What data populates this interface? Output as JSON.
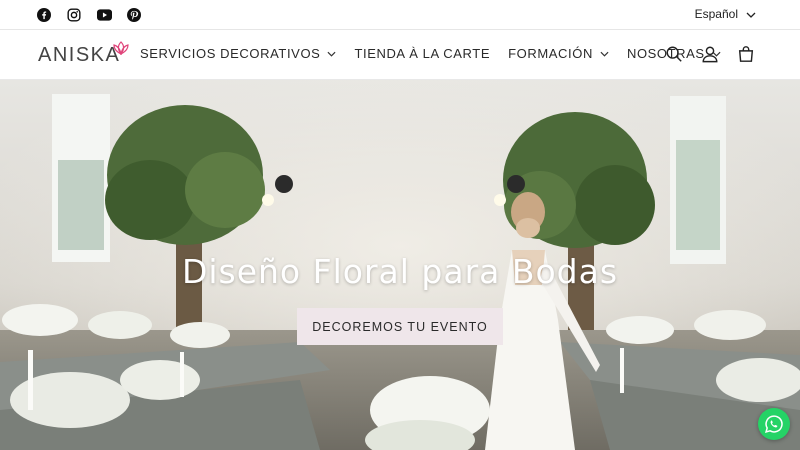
{
  "topbar": {
    "social": [
      "facebook-icon",
      "instagram-icon",
      "youtube-icon",
      "pinterest-icon"
    ],
    "language": "Español"
  },
  "header": {
    "logo": "ANISKA",
    "nav": [
      {
        "label": "SERVICIOS DECORATIVOS",
        "dropdown": true
      },
      {
        "label": "TIENDA À LA CARTE",
        "dropdown": false
      },
      {
        "label": "FORMACIÓN",
        "dropdown": true
      },
      {
        "label": "NOSOTRAS",
        "dropdown": true
      }
    ],
    "icons": [
      "search-icon",
      "account-icon",
      "cart-icon"
    ]
  },
  "hero": {
    "title": "Diseño Floral para Bodas",
    "button": "DECOREMOS TU EVENTO"
  },
  "colors": {
    "accent": "#e0457b",
    "button_bg": "#efe6ea",
    "whatsapp": "#25d366"
  }
}
